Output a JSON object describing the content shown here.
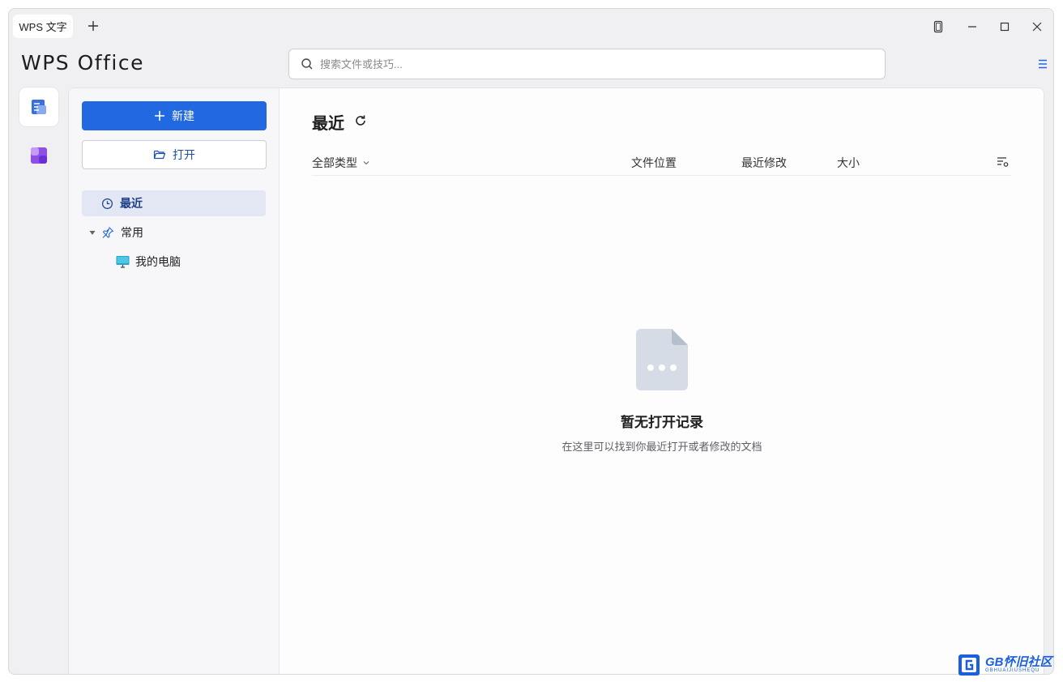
{
  "titlebar": {
    "tab_label": "WPS 文字"
  },
  "header": {
    "logo_text": "WPS Office",
    "search_placeholder": "搜索文件或技巧..."
  },
  "nav": {
    "new_label": "新建",
    "open_label": "打开",
    "recent_label": "最近",
    "common_label": "常用",
    "my_computer_label": "我的电脑"
  },
  "content": {
    "title": "最近",
    "columns": {
      "type_filter": "全部类型",
      "location": "文件位置",
      "modified": "最近修改",
      "size": "大小"
    },
    "empty_title": "暂无打开记录",
    "empty_subtitle": "在这里可以找到你最近打开或者修改的文档"
  },
  "watermark": {
    "title": "GB怀旧社区",
    "subtitle": "GBHUAIJIUSHEQU"
  },
  "colors": {
    "accent": "#2168e1",
    "window_bg": "#f0eff1",
    "selected_nav": "#e2e7f3"
  }
}
